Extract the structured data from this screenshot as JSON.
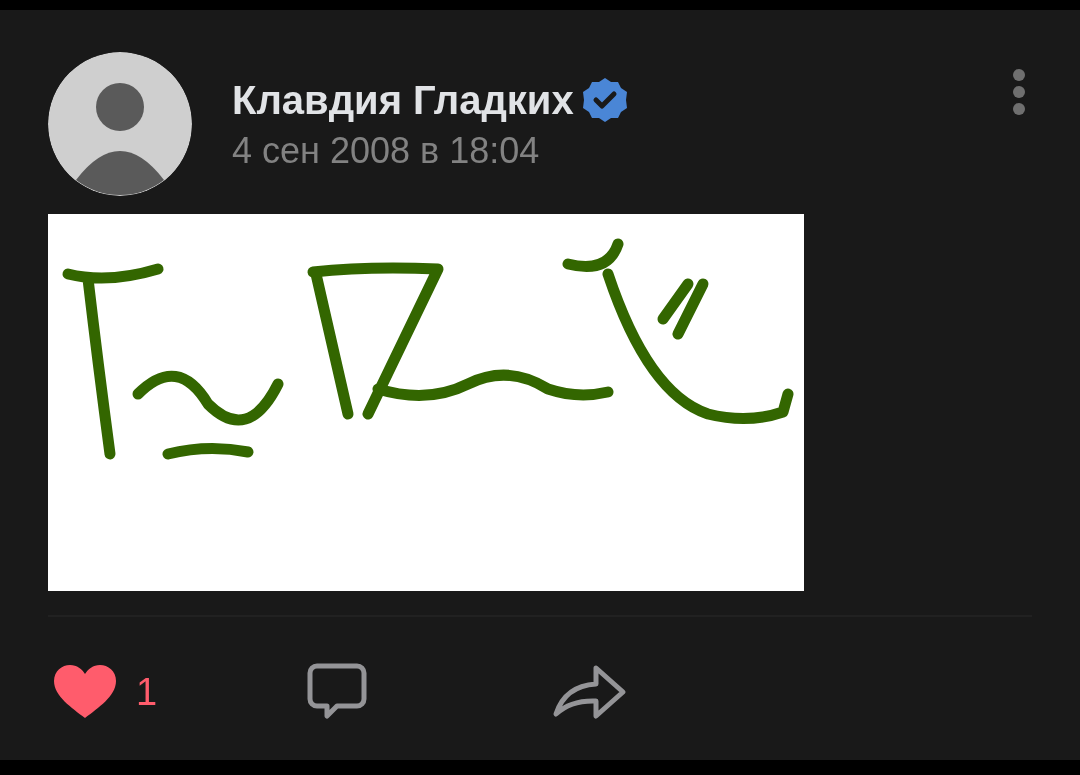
{
  "post": {
    "author": {
      "name": "Клавдия Гладких",
      "verified": true
    },
    "date": "4 сен 2008 в 18:04",
    "actions": {
      "like": {
        "liked": true,
        "count": "1"
      }
    }
  }
}
